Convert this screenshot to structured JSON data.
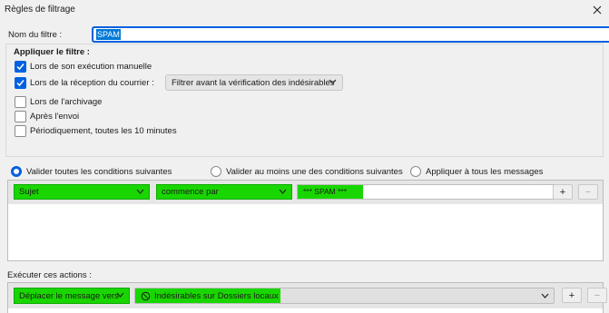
{
  "window": {
    "title": "Règles de filtrage"
  },
  "name": {
    "label": "Nom du filtre :",
    "value": "SPAM"
  },
  "apply": {
    "title": "Appliquer le filtre :",
    "options": [
      {
        "label": "Lors de son exécution manuelle",
        "checked": true
      },
      {
        "label": "Lors de la réception du courrier :",
        "checked": true
      },
      {
        "label": "Lors de l'archivage",
        "checked": false
      },
      {
        "label": "Après l'envoi",
        "checked": false
      },
      {
        "label": "Périodiquement, toutes les 10 minutes",
        "checked": false
      }
    ],
    "reception_dropdown": "Filtrer avant la vérification des indésirables"
  },
  "match": {
    "all": "Valider toutes les conditions suivantes",
    "any": "Valider au moins une des conditions suivantes",
    "every": "Appliquer à tous les messages",
    "selected": "all"
  },
  "condition": {
    "field": "Sujet",
    "operator": "commence par",
    "value": "*** SPAM ***"
  },
  "actions": {
    "label": "Exécuter ces actions :",
    "action": "Déplacer le message vers",
    "folder": "Indésirables sur Dossiers locaux"
  },
  "buttons": {
    "add": "+",
    "remove": "−"
  },
  "colors": {
    "accent": "#0060df",
    "highlight": "#19d600"
  }
}
